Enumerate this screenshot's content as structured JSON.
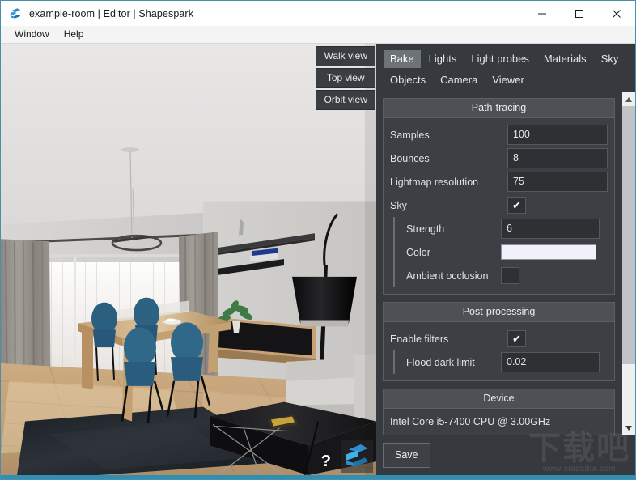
{
  "window": {
    "title": "example-room | Editor | Shapespark",
    "logo_icon": "shapespark-logo-icon",
    "controls": [
      {
        "name": "minimize",
        "glyph": "─"
      },
      {
        "name": "maximize",
        "glyph": "☐"
      },
      {
        "name": "close",
        "glyph": "✕"
      }
    ]
  },
  "menubar": {
    "items": [
      {
        "label": "Window"
      },
      {
        "label": "Help"
      }
    ]
  },
  "viewport": {
    "view_buttons": [
      {
        "label": "Walk view",
        "active": false
      },
      {
        "label": "Top view",
        "active": false
      },
      {
        "label": "Orbit view",
        "active": false
      }
    ],
    "help_glyph": "?",
    "brand_icon": "shapespark-logo-icon",
    "scene_description": "Rendered interior: dining room with wooden table, four blue chairs, pendant ring lamp, curtained window, black arc floor lamp, grey sofa, black coffee table on dark rug, parquet floor"
  },
  "panel": {
    "tabs": [
      {
        "label": "Bake",
        "active": true
      },
      {
        "label": "Lights",
        "active": false
      },
      {
        "label": "Light probes",
        "active": false
      },
      {
        "label": "Materials",
        "active": false
      },
      {
        "label": "Sky",
        "active": false
      },
      {
        "label": "Objects",
        "active": false
      },
      {
        "label": "Camera",
        "active": false
      },
      {
        "label": "Viewer",
        "active": false
      }
    ],
    "groups": {
      "path_tracing": {
        "title": "Path-tracing",
        "samples": {
          "label": "Samples",
          "value": "100"
        },
        "bounces": {
          "label": "Bounces",
          "value": "8"
        },
        "lightmap_resolution": {
          "label": "Lightmap resolution",
          "value": "75"
        },
        "sky": {
          "label": "Sky",
          "checked": true,
          "check_glyph": "✔"
        },
        "strength": {
          "label": "Strength",
          "value": "6"
        },
        "color": {
          "label": "Color",
          "value": "#f2f0fa"
        },
        "ambient_occlusion": {
          "label": "Ambient occlusion",
          "checked": false,
          "check_glyph": ""
        }
      },
      "post_processing": {
        "title": "Post-processing",
        "enable_filters": {
          "label": "Enable filters",
          "checked": true,
          "check_glyph": "✔"
        },
        "flood_dark_limit": {
          "label": "Flood dark limit",
          "value": "0.02"
        }
      },
      "device": {
        "title": "Device",
        "value": "Intel Core i5-7400 CPU @ 3.00GHz"
      }
    },
    "scrollbar": {
      "up_glyph": "▲",
      "down_glyph": "▼"
    },
    "footer": {
      "save_label": "Save"
    }
  },
  "watermark": {
    "cjk": "下载吧",
    "url": "www.xiazaiba.com"
  },
  "colors": {
    "accent": "#2f8fb5",
    "panel_bg": "#36393d",
    "group_bg": "#3c3f44",
    "field_bg": "#2e3134",
    "tab_active_bg": "#6e7279",
    "chair_blue": "#2b5f80"
  }
}
